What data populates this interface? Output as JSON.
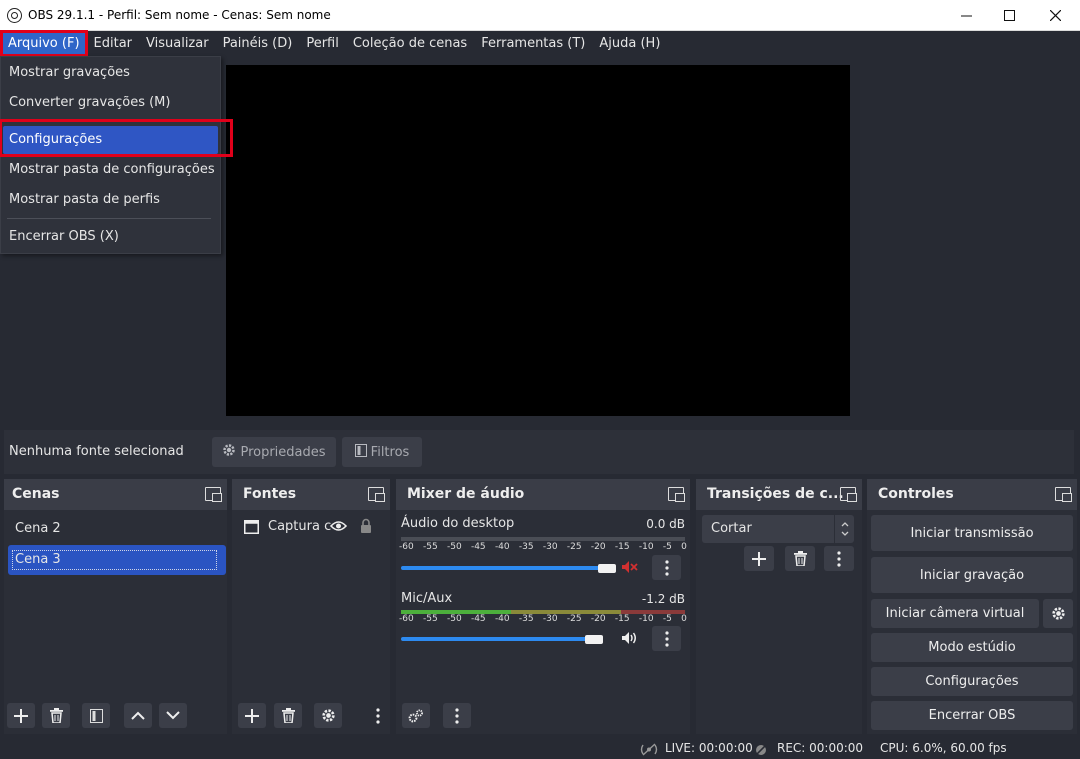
{
  "window": {
    "title": "OBS 29.1.1 - Perfil: Sem nome - Cenas: Sem nome",
    "controls": [
      "minimize-icon",
      "maximize-icon",
      "close-icon"
    ]
  },
  "menu": {
    "items": [
      "Arquivo (F)",
      "Editar",
      "Visualizar",
      "Painéis (D)",
      "Perfil",
      "Coleção de cenas",
      "Ferramentas (T)",
      "Ajuda (H)"
    ]
  },
  "file_menu": {
    "items": [
      "Mostrar gravações",
      "Converter gravações (M)",
      "Configurações",
      "Mostrar pasta de configurações",
      "Mostrar pasta de perfis",
      "Encerrar OBS (X)"
    ]
  },
  "source_bar": {
    "no_source": "Nenhuma fonte selecionad",
    "properties": "Propriedades",
    "filters": "Filtros"
  },
  "scenes": {
    "title": "Cenas",
    "items": [
      "Cena 2",
      "Cena 3"
    ]
  },
  "sources": {
    "title": "Fontes",
    "items": [
      "Captura c"
    ]
  },
  "mixer": {
    "title": "Mixer de áudio",
    "channels": [
      {
        "name": "Áudio do desktop",
        "db": "0.0 dB",
        "volume_fraction": 1.0,
        "muted": true
      },
      {
        "name": "Mic/Aux",
        "db": "-1.2 dB",
        "volume_fraction": 0.95,
        "muted": false
      }
    ],
    "ticks": [
      "-60",
      "-55",
      "-50",
      "-45",
      "-40",
      "-35",
      "-30",
      "-25",
      "-20",
      "-15",
      "-10",
      "-5",
      "0"
    ]
  },
  "transitions": {
    "title": "Transições de c...",
    "selected": "Cortar"
  },
  "controls": {
    "title": "Controles",
    "start_stream": "Iniciar transmissão",
    "start_recording": "Iniciar gravação",
    "start_virtual_cam": "Iniciar câmera virtual",
    "studio_mode": "Modo estúdio",
    "settings": "Configurações",
    "exit": "Encerrar OBS"
  },
  "status": {
    "live": "LIVE: 00:00:00",
    "rec": "REC: 00:00:00",
    "cpu": "CPU: 6.0%, 60.00 fps"
  },
  "colors": {
    "accent": "#2f56c4",
    "highlight_box": "#e0001a",
    "background": "#272a33"
  }
}
